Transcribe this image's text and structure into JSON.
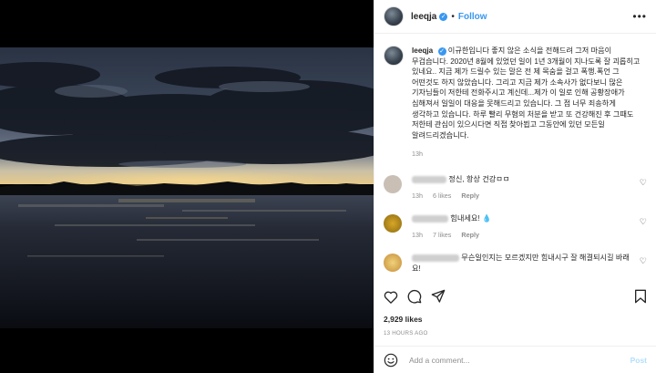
{
  "post": {
    "username": "leeqja",
    "verified_badge": "✓",
    "separator": "•",
    "follow_label": "Follow",
    "more_icon": "•••",
    "caption": "이규한입니다 좋지 않은 소식을 전해드려 그저 마음이 무겁습니다. 2020년 8월에 있었던 일이 1년 3개월이 지나도록 잘 괴롭히고 있네요.. 지금 제가 드릴수 있는 말은 전 제 목숨을 걸고 폭행.폭언 그 어떤것도 하지 않았습니다. 그리고 지금 제가 소속사가 없다보니 많은 기자님들이 저한테 전화주시고 계신데...제가 이 일로 인해 공황장애가 심해져서 일일이 대응을 못해드리고 있습니다. 그 점 너무 죄송하게 생각하고 있습니다. 하루 빨리 무혐의 처분을 받고 또 건강해진 후 그때도 저한테 관심이 있으시다면 직접 찾아뵙고 그동안에 있던 모든일 알려드리겠습니다.",
    "caption_time": "13h",
    "likes": "2,929 likes",
    "time_ago": "13 HOURS AGO",
    "add_comment_placeholder": "Add a comment...",
    "post_label": "Post"
  },
  "comments": [
    {
      "text": "정신, 항상 건강ㅁㅁ",
      "time": "13h",
      "likes": "6 likes",
      "reply": "Reply",
      "avatar_color": "#c9bfb5"
    },
    {
      "text": "힘내세요! 💧",
      "time": "13h",
      "likes": "7 likes",
      "reply": "Reply",
      "avatar_color": "#b8901f"
    },
    {
      "text": "무슨일인지는 모르겠지만 힘내시구 잘 해결되시길 바래요!",
      "time": "",
      "likes": "",
      "reply": "",
      "avatar_color": "#e0b84a"
    }
  ],
  "icons": {
    "heart": "heart-icon",
    "comment": "comment-icon",
    "share": "share-icon",
    "bookmark": "bookmark-icon",
    "smile": "smile-icon"
  },
  "colors": {
    "accent": "#3897f0",
    "muted": "#8e8e8e",
    "post_disabled": "#b2dffc"
  }
}
